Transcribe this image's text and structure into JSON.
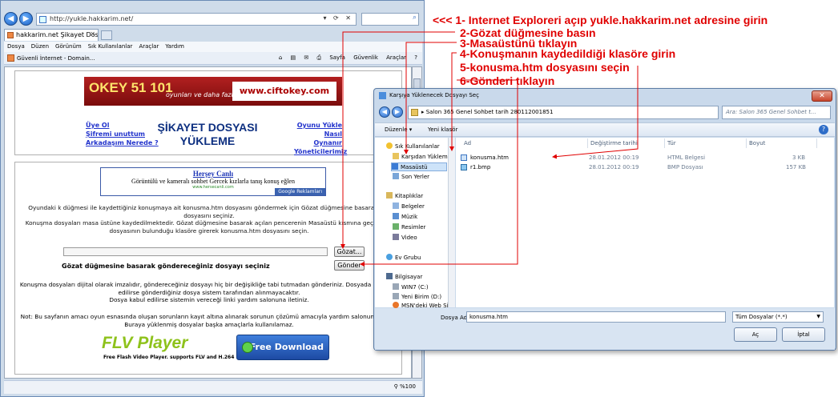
{
  "ie": {
    "url": "http://yukle.hakkarim.net/",
    "tab_title": "hakkarim.net Şikayet Dosya...",
    "menu": [
      "Dosya",
      "Düzen",
      "Görünüm",
      "Sık Kullanılanlar",
      "Araçlar",
      "Yardım"
    ],
    "favorite": "Güvenli İnternet - Domain...",
    "tools": [
      "Sayfa",
      "Güvenlik",
      "Araçlar"
    ],
    "zoom": "%100"
  },
  "page": {
    "banner1": {
      "okey": "OKEY 51 101",
      "sub": "oyunları ve daha fazlası...",
      "url": "www.ciftokey.com"
    },
    "links_left": [
      "Üye Ol",
      "Şifremi unuttum",
      "Arkadaşım Nerede ?"
    ],
    "title_line1": "ŞİKAYET DOSYASI",
    "title_line2": "YÜKLEME",
    "links_right": [
      "Oyunu Yükle",
      "Nasıl Oynanır",
      "Yöneticilerimiz"
    ],
    "banner2": {
      "title": "Herşey Canlı",
      "text": "Görüntülü ve kameralı sohbet Gercek kızlarla tanış konuş eğlen",
      "url": "www.hersecanli.com",
      "ads": "Google Reklamları"
    },
    "instructions": [
      "Oyundaki k düğmesi ile kaydettiğiniz konuşmaya ait konusma.htm dosyasını göndermek için Gözat düğmesine basarak kon",
      "dosyasını seçiniz.",
      "Konuşma dosyaları masa üstüne kaydedilmektedir. Gözat düğmesine basarak açılan pencerenin Masaüstü kısmına geçin ve k",
      "dosyasının bulunduğu klasöre girerek konusma.htm dosyasını seçin."
    ],
    "browse_button": "Gözat...",
    "pick_label": "Gözat düğmesine basarak göndereceğiniz dosyayı seçiniz",
    "send_button": "Gönder",
    "paragraph": [
      "Konuşma dosyaları dijital olarak imzalıdır, göndereceğiniz dosyayı hiç bir değişikliğe tabi tutmadan gönderiniz. Dosyada bir değiş",
      "edilirse gönderdiğiniz dosya sistem tarafından alınmayacaktır.",
      "Dosya kabul edilirse sistemin vereceği linki yardım salonuna iletiniz."
    ],
    "note": [
      "Not: Bu sayfanın amacı oyun esnasında oluşan sorunların kayıt altına alınarak sorunun çözümü amacıyla yardım salonuna iletilm",
      "Buraya yüklenmiş dosyalar başka amaçlarla kullanılamaz."
    ],
    "flv": {
      "logo": "FLV Player",
      "tagline": "Free Flash Video Player. supports FLV and H.264",
      "download": "Free Download"
    }
  },
  "dialog": {
    "title": "Karşıya Yüklenecek Dosyayı Seç",
    "breadcrumb": "▸ Salon 365 Genel Sohbet  tarih 280112001851",
    "search_placeholder": "Ara: Salon 365 Genel Sohbet  t...",
    "toolbar": [
      "Düzenle ▾",
      "Yeni klasör"
    ],
    "nav": [
      {
        "label": "Sık Kullanılanlar",
        "icon": "star-icon"
      },
      {
        "label": "Karşıdan Yüklem",
        "icon": "download-folder-icon"
      },
      {
        "label": "Masaüstü",
        "icon": "desktop-icon"
      },
      {
        "label": "Son Yerler",
        "icon": "recent-places-icon"
      },
      {
        "label": "Kitaplıklar",
        "icon": "libraries-icon"
      },
      {
        "label": "Belgeler",
        "icon": "documents-icon"
      },
      {
        "label": "Müzik",
        "icon": "music-icon"
      },
      {
        "label": "Resimler",
        "icon": "pictures-icon"
      },
      {
        "label": "Video",
        "icon": "video-icon"
      },
      {
        "label": "Ev Grubu",
        "icon": "homegroup-icon"
      },
      {
        "label": "Bilgisayar",
        "icon": "computer-icon"
      },
      {
        "label": "WIN7 (C:)",
        "icon": "drive-icon"
      },
      {
        "label": "Yeni Birim (D:)",
        "icon": "drive-icon"
      },
      {
        "label": "MSN'deki Web Si",
        "icon": "msn-icon"
      }
    ],
    "columns": [
      "Ad",
      "Değiştirme tarihi",
      "Tür",
      "Boyut"
    ],
    "files": [
      {
        "name": "konusma.htm",
        "date": "28.01.2012 00:19",
        "type": "HTML Belgesi",
        "size": "3 KB"
      },
      {
        "name": "r1.bmp",
        "date": "28.01.2012 00:19",
        "type": "BMP Dosyası",
        "size": "157 KB"
      }
    ],
    "filename_label": "Dosya Adı:",
    "filename_value": "konusma.htm",
    "filetype": "Tüm Dosyalar (*.*)",
    "open_button": "Aç",
    "cancel_button": "İptal"
  },
  "annotations": [
    "<<< 1- Internet Exploreri açıp yukle.hakkarim.net adresine girin",
    "2-Gözat düğmesine basın",
    "3-Masaüstünü tıklayın",
    "4-Konuşmanın kaydedildiği klasöre girin",
    "5-konusma.htm dosyasını seçin",
    "6-Gönderi tıklayın"
  ],
  "colors": {
    "annotation": "#e00000",
    "ie_frame": "#cfdcea",
    "dialog_frame": "#c9d9eb"
  }
}
